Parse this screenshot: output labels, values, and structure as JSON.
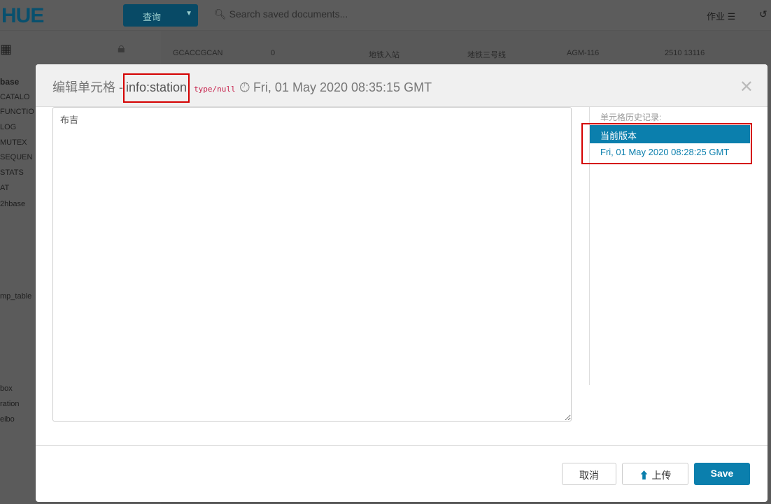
{
  "app": {
    "logo": "HUE",
    "query_button": "查询",
    "search_placeholder": "Search saved documents...",
    "jobs": "作业"
  },
  "sidebar": {
    "items": [
      "base",
      "CATALO",
      "FUNCTIO",
      "LOG",
      "MUTEX",
      "SEQUEN",
      "STATS",
      "AT",
      "2hbase",
      "mp_table",
      "box",
      "ration",
      "eibo"
    ]
  },
  "background_row": [
    "GCACCGCAN",
    "0",
    "地铁入站",
    "地铁三号线",
    "AGM-116",
    "2510 13116"
  ],
  "modal": {
    "title_prefix": "编辑单元格 -",
    "column": "info:station",
    "type": "type/null",
    "timestamp": "Fri, 01 May 2020 08:35:15 GMT",
    "value": "布吉",
    "history_label": "单元格历史记录:",
    "history": [
      "当前版本",
      "Fri, 01 May 2020 08:28:25 GMT"
    ],
    "buttons": {
      "cancel": "取消",
      "upload": "上传",
      "save": "Save"
    }
  }
}
